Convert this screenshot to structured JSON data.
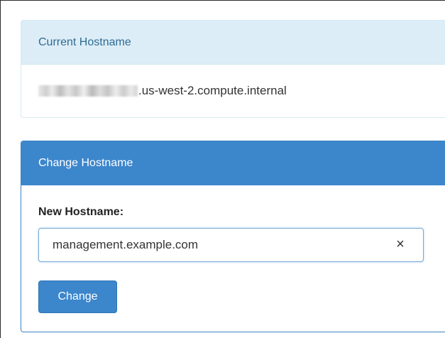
{
  "current_hostname": {
    "heading": "Current Hostname",
    "value_suffix": ".us-west-2.compute.internal"
  },
  "change_hostname": {
    "heading": "Change Hostname",
    "field_label": "New Hostname:",
    "input_value": "management.example.com",
    "clear_icon": "×",
    "button_label": "Change"
  },
  "colors": {
    "info_heading_bg": "#dcedf7",
    "info_heading_text": "#2f6b93",
    "primary": "#3c86cc",
    "input_focus_border": "#77a8d6"
  },
  "icons": {
    "clear": "close-icon"
  }
}
